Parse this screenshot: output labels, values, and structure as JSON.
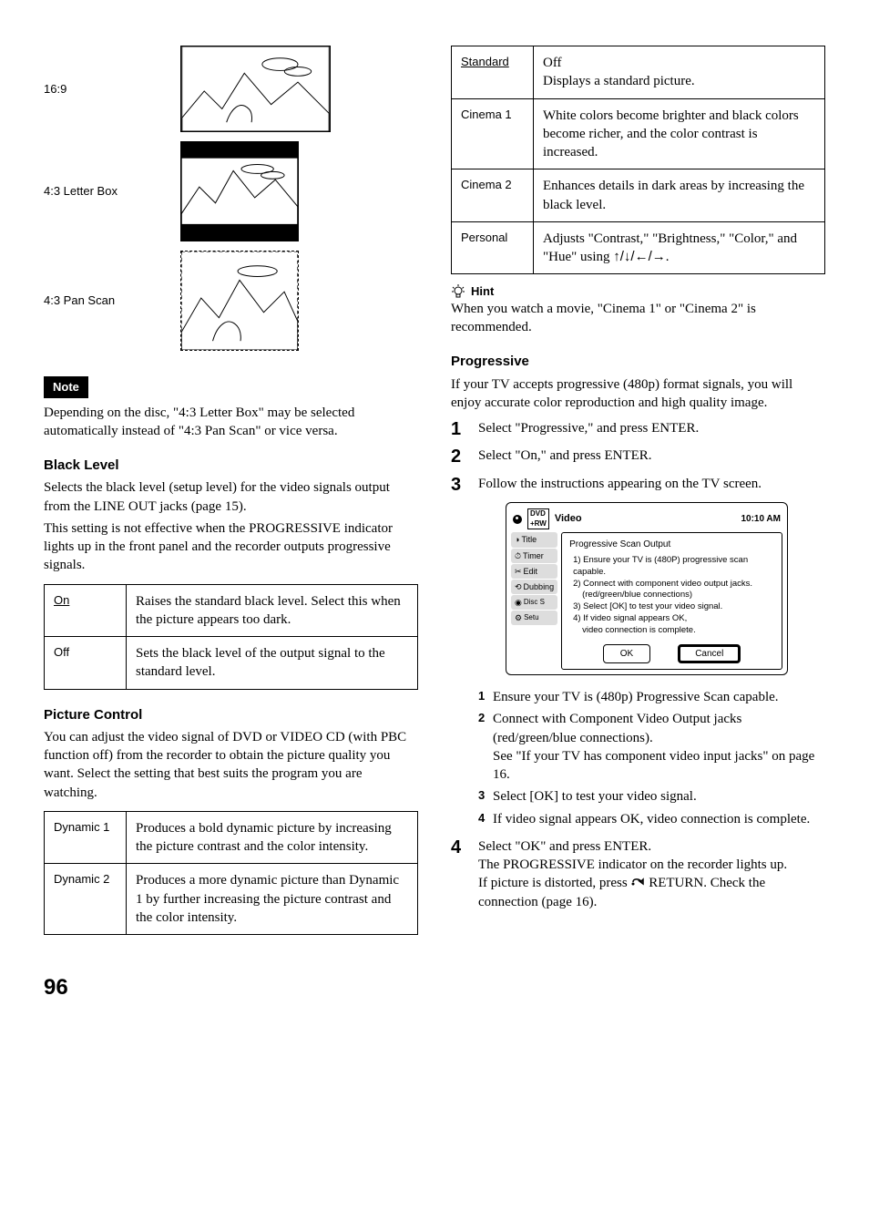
{
  "left": {
    "ratios": [
      {
        "label": "16:9"
      },
      {
        "label": "4:3 Letter Box"
      },
      {
        "label": "4:3 Pan Scan"
      }
    ],
    "noteBadge": "Note",
    "noteText": "Depending on the disc, \"4:3 Letter Box\" may be selected automatically instead of \"4:3 Pan Scan\" or vice versa.",
    "blackLevel": {
      "heading": "Black Level",
      "intro": "Selects the black level (setup level) for the video signals output from the LINE OUT jacks (page 15).",
      "intro2": "This setting is not effective when the PROGRESSIVE indicator lights up in the front panel and the recorder outputs progressive signals.",
      "rows": [
        {
          "label": "On",
          "underline": true,
          "desc": "Raises the standard black level. Select this when the picture appears too dark."
        },
        {
          "label": "Off",
          "underline": false,
          "desc": "Sets the black level of the output signal to the standard level."
        }
      ]
    },
    "pictureControl": {
      "heading": "Picture Control",
      "intro": "You can adjust the video signal of DVD or VIDEO CD (with PBC function off) from the recorder to obtain the picture quality you want. Select the setting that best suits the program you are watching.",
      "rows": [
        {
          "label": "Dynamic 1",
          "desc": "Produces a bold dynamic picture by increasing the picture contrast and the color intensity."
        },
        {
          "label": "Dynamic 2",
          "desc": "Produces a more dynamic picture than Dynamic 1 by further increasing the picture contrast and the color intensity."
        }
      ]
    }
  },
  "right": {
    "topTable": [
      {
        "label": "Standard",
        "underline": true,
        "desc": "Off\nDisplays a standard picture."
      },
      {
        "label": "Cinema 1",
        "desc": "White colors become brighter and black colors become richer, and the color contrast is increased."
      },
      {
        "label": "Cinema 2",
        "desc": "Enhances details in dark areas by increasing the black level."
      },
      {
        "label": "Personal",
        "desc": "Adjusts \"Contrast,\" \"Brightness,\" \"Color,\" and \"Hue\" using ",
        "arrows": true,
        "descTail": "."
      }
    ],
    "hintLabel": "Hint",
    "hintText": "When you watch a movie, \"Cinema 1\" or \"Cinema 2\" is recommended.",
    "progressive": {
      "heading": "Progressive",
      "intro": "If your TV accepts progressive (480p) format signals, you will enjoy accurate color reproduction and high quality image.",
      "steps": [
        "Select \"Progressive,\" and press ENTER.",
        "Select \"On,\" and press ENTER.",
        "Follow the instructions appearing on the TV screen."
      ],
      "screenshot": {
        "title": "Video",
        "time": "10:10 AM",
        "sidebar": [
          "Title",
          "Timer",
          "Edit",
          "Dubbing",
          "Disc Setting",
          "Setup"
        ],
        "mainHeading": "Progressive Scan Output",
        "lines": [
          {
            "n": "1)",
            "t": "Ensure your TV is (480P) progressive scan capable."
          },
          {
            "n": "2)",
            "t": "Connect with component video output jacks."
          },
          {
            "n": "",
            "t": "(red/green/blue connections)",
            "indent": true
          },
          {
            "n": "3)",
            "t": "Select [OK] to test your video signal."
          },
          {
            "n": "4)",
            "t": "If video signal appears OK,"
          },
          {
            "n": "",
            "t": "video connection is complete.",
            "indent": true
          }
        ],
        "okLabel": "OK",
        "cancelLabel": "Cancel"
      },
      "substeps": [
        "Ensure your TV is (480p) Progressive Scan capable.",
        "Connect with Component Video Output jacks (red/green/blue connections).\nSee \"If your TV has component video input jacks\"  on page 16.",
        "Select [OK] to test your video signal.",
        "If video signal appears OK, video connection is complete."
      ],
      "step4a": "Select \"OK\" and press ENTER.",
      "step4b": "The PROGRESSIVE indicator on the recorder lights up.",
      "step4c1": "If picture is distorted, press ",
      "step4c2": " RETURN. Check the connection (page 16)."
    }
  },
  "pageNumber": "96"
}
